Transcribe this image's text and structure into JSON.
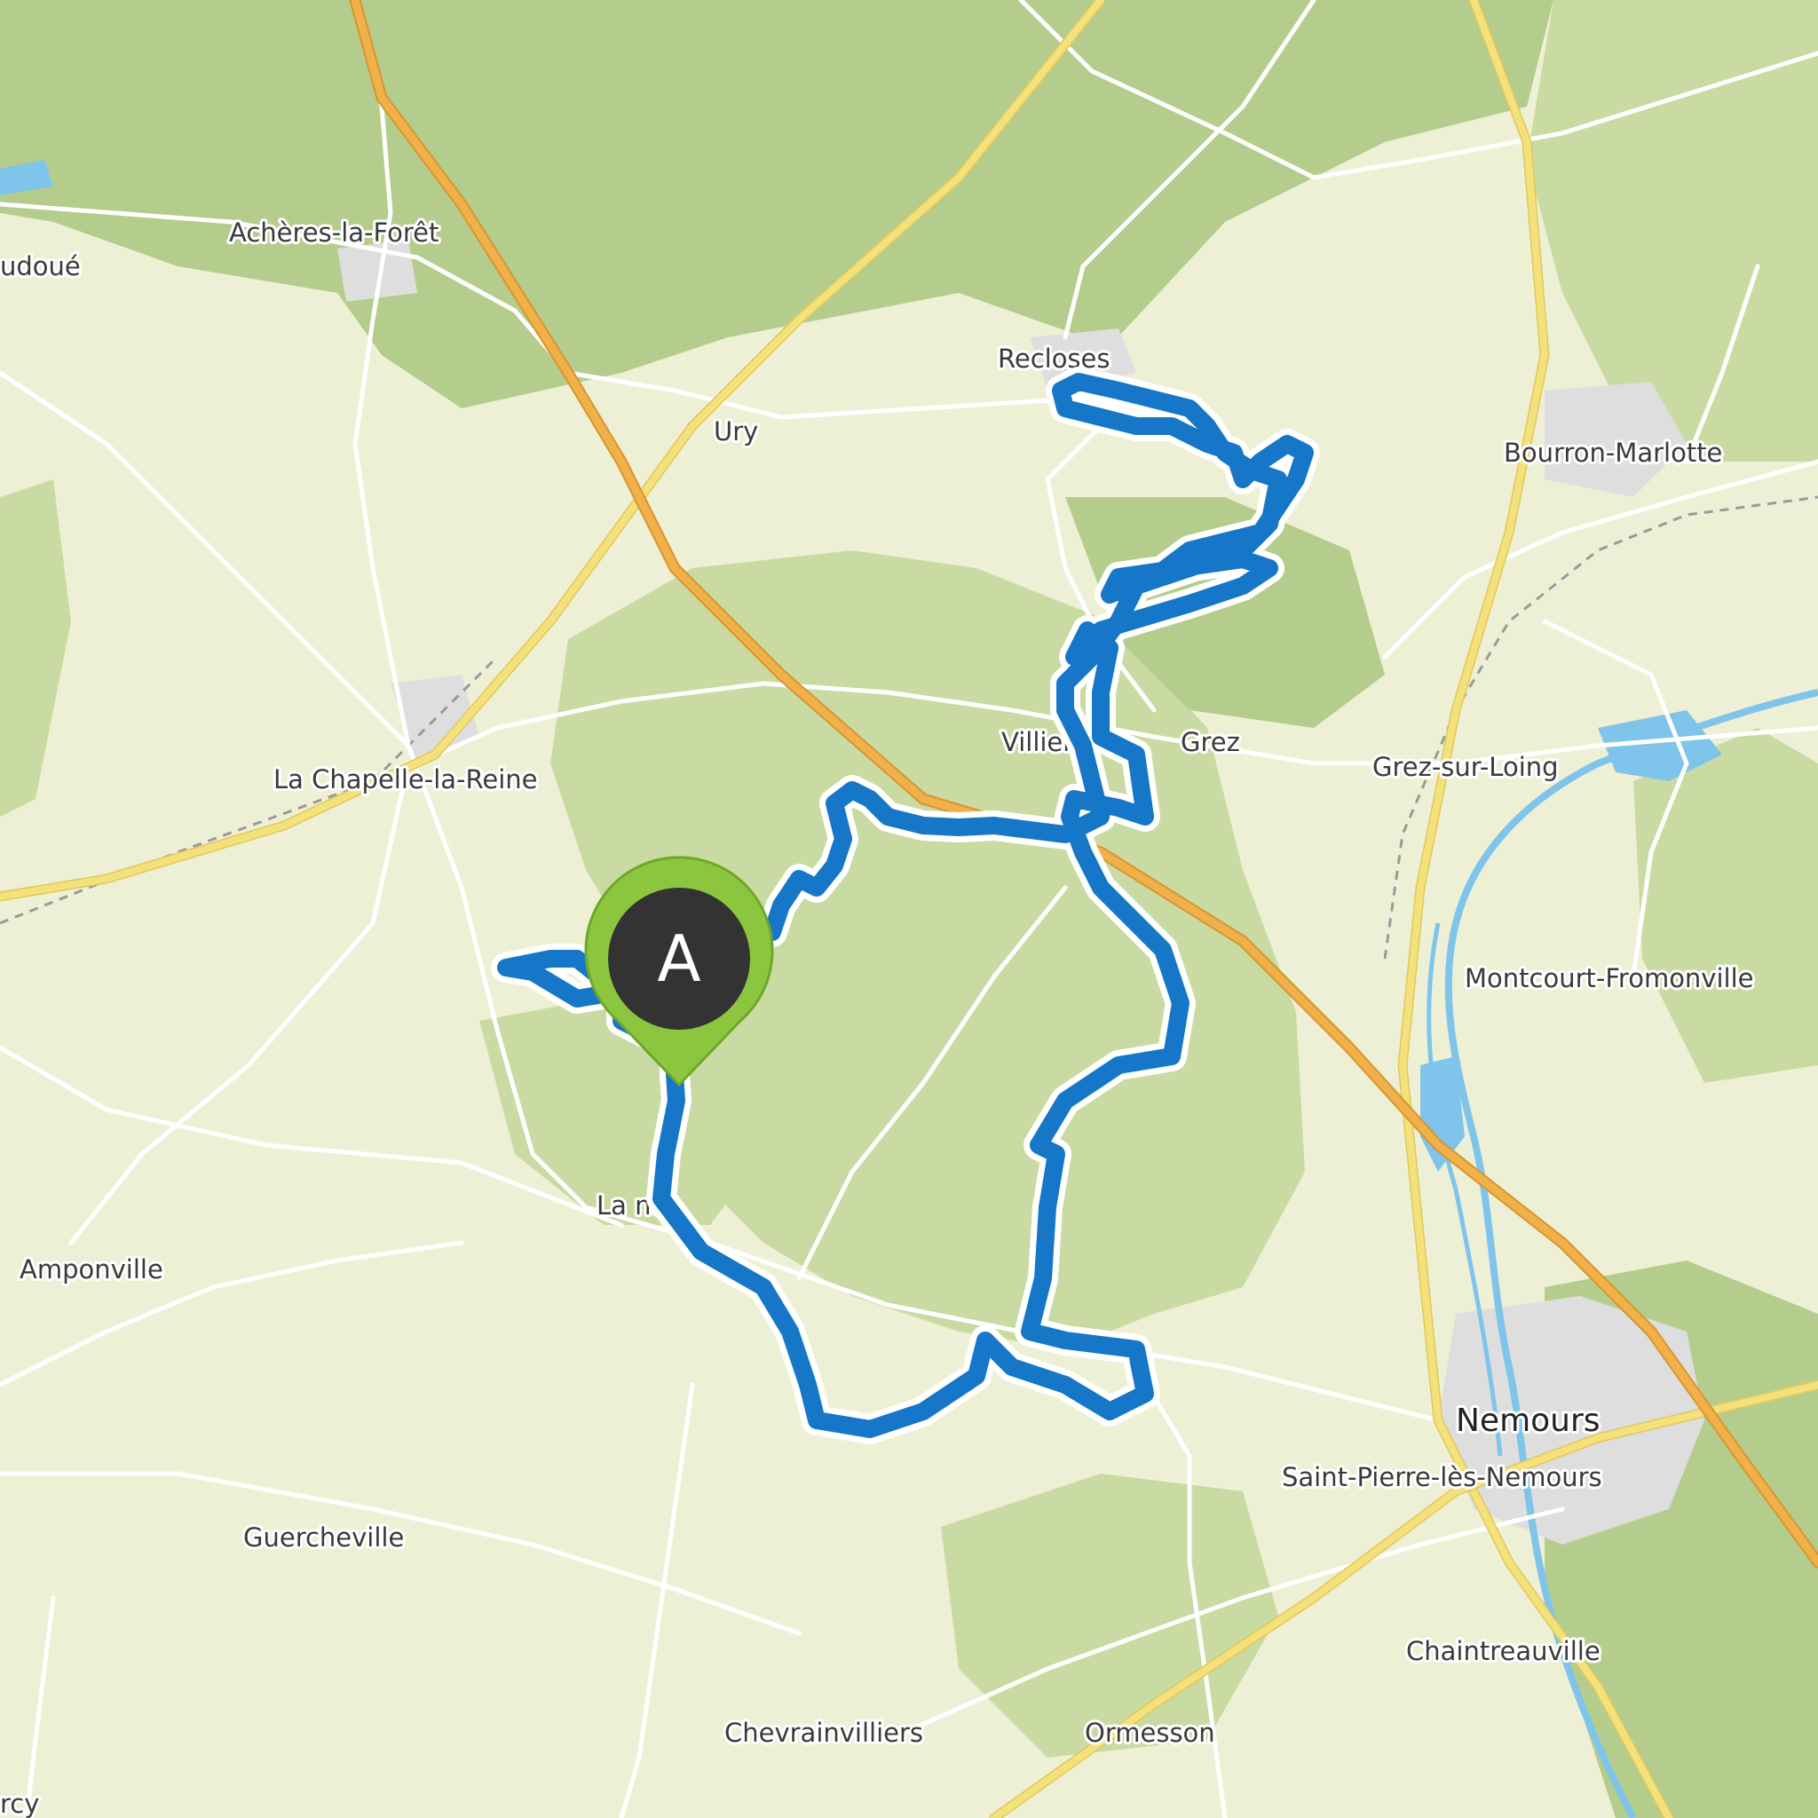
{
  "map": {
    "colors": {
      "land": "#eef0d6",
      "forest": "#c9dba2",
      "forest_dark": "#b5cd8c",
      "urban": "#dedede",
      "water": "#7fc4ea",
      "motorway": "#f0b04a",
      "primary_road": "#f3e17b",
      "minor_road": "#ffffff",
      "route": "#1677c8",
      "route_halo": "#ffffff",
      "marker_head": "#333333",
      "marker_ring": "#8cc63f"
    },
    "places": [
      {
        "id": "acheres",
        "name": "Achères-la-Forêt",
        "kind": "village"
      },
      {
        "id": "audoue",
        "name": "udoué",
        "kind": "village"
      },
      {
        "id": "recloses",
        "name": "Recloses",
        "kind": "village"
      },
      {
        "id": "ury",
        "name": "Ury",
        "kind": "village"
      },
      {
        "id": "bourron",
        "name": "Bourron-Marlotte",
        "kind": "village"
      },
      {
        "id": "villiers",
        "name": "Villiers",
        "kind": "village"
      },
      {
        "id": "grez",
        "name": "Grez",
        "kind": "village"
      },
      {
        "id": "grezloing",
        "name": "Grez-sur-Loing",
        "kind": "village"
      },
      {
        "id": "chapelle",
        "name": "La Chapelle-la-Reine",
        "kind": "village"
      },
      {
        "id": "montcourt",
        "name": "Montcourt-Fromonville",
        "kind": "village"
      },
      {
        "id": "larochette",
        "name": "La     nt",
        "kind": "village"
      },
      {
        "id": "amponville",
        "name": "Amponville",
        "kind": "village"
      },
      {
        "id": "nemours",
        "name": "Nemours",
        "kind": "town"
      },
      {
        "id": "stpierre",
        "name": "Saint-Pierre-lès-Nemours",
        "kind": "village"
      },
      {
        "id": "guercheville",
        "name": "Guercheville",
        "kind": "village"
      },
      {
        "id": "chaintreauville",
        "name": "Chaintreauville",
        "kind": "village"
      },
      {
        "id": "chevrainvilliers",
        "name": "Chevrainvilliers",
        "kind": "village"
      },
      {
        "id": "ormesson",
        "name": "Ormesson",
        "kind": "village"
      },
      {
        "id": "arcy",
        "name": "rcy",
        "kind": "village"
      }
    ],
    "route": {
      "name": "",
      "start_marker": {
        "label": "A",
        "icon": "map-pin-icon"
      }
    }
  }
}
